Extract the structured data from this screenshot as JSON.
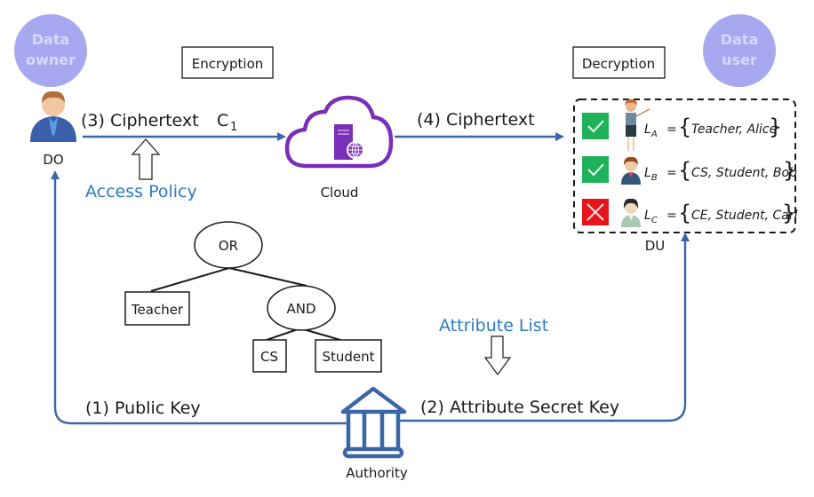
{
  "roles": {
    "data_owner_badge": [
      "Data",
      "owner"
    ],
    "data_user_badge": [
      "Data",
      "user"
    ],
    "do_label": "DO",
    "du_label": "DU",
    "cloud_label": "Cloud",
    "authority_label": "Authority"
  },
  "phases": {
    "encryption": "Encryption",
    "decryption": "Decryption"
  },
  "flows": {
    "step3": "(3) Ciphertext",
    "step3_symbol": "C",
    "step3_subscript": "1",
    "step4": "(4) Ciphertext",
    "step1": "(1) Public Key",
    "step2": "(2) Attribute Secret Key",
    "access_policy": "Access Policy",
    "attribute_list": "Attribute List"
  },
  "policy_tree": {
    "root": "OR",
    "left_leaf": "Teacher",
    "and_node": "AND",
    "and_left": "CS",
    "and_right": "Student"
  },
  "users": [
    {
      "label": "L",
      "sub": "A",
      "attributes": "Teacher, Alice",
      "status": "granted"
    },
    {
      "label": "L",
      "sub": "B",
      "attributes": "CS, Student, Bob",
      "status": "granted"
    },
    {
      "label": "L",
      "sub": "C",
      "attributes": "CE, Student, Carl",
      "status": "denied"
    }
  ],
  "colors": {
    "flow_blue": "#3a66a8",
    "text_blue": "#2e7bc4",
    "badge_purple": "#a8a8f0",
    "cloud_purple": "#7a2fb8",
    "granted_green": "#1fb25a",
    "denied_red": "#e8141c"
  }
}
